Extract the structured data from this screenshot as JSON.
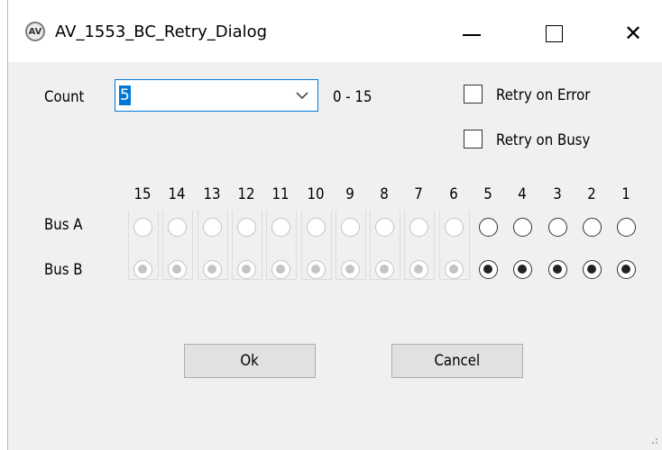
{
  "window": {
    "title": "AV_1553_BC_Retry_Dialog",
    "app_icon_text": "AV"
  },
  "count": {
    "label": "Count",
    "value": "5",
    "range": "0 - 15"
  },
  "options": {
    "retry_on_error": {
      "label": "Retry on Error",
      "checked": false
    },
    "retry_on_busy": {
      "label": "Retry on Busy",
      "checked": false
    }
  },
  "bus_grid": {
    "bits": [
      "15",
      "14",
      "13",
      "12",
      "11",
      "10",
      "9",
      "8",
      "7",
      "6",
      "5",
      "4",
      "3",
      "2",
      "1"
    ],
    "enabled_count": 5,
    "bus_a": {
      "label": "Bus A"
    },
    "bus_b": {
      "label": "Bus B"
    }
  },
  "buttons": {
    "ok": "Ok",
    "cancel": "Cancel"
  },
  "colors": {
    "accent": "#0078d7",
    "dialog_bg": "#f0f0f0",
    "button_bg": "#e1e1e1",
    "disabled": "#c4c4c4"
  }
}
